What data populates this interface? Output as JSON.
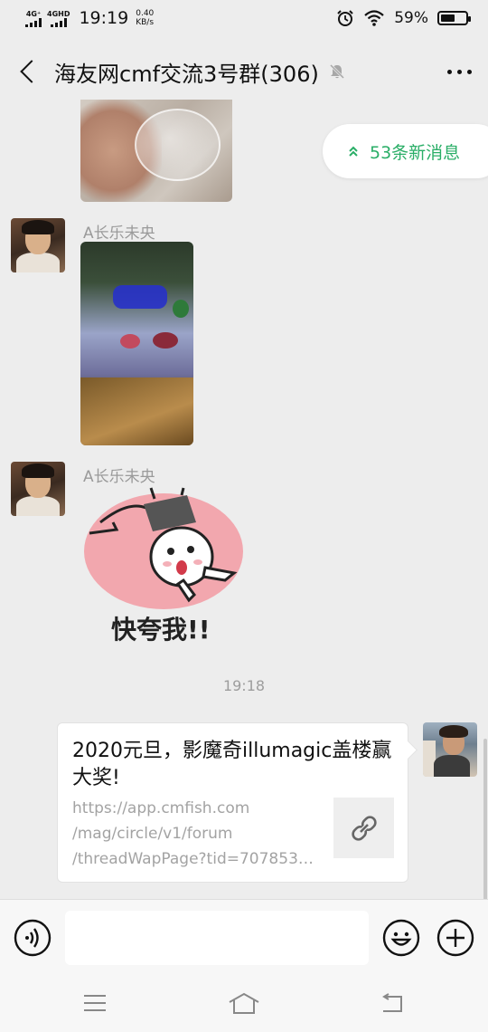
{
  "status_bar": {
    "sim1_label": "4G⁺",
    "sim2_label": "4GHD",
    "time": "19:19",
    "speed_value": "0.40",
    "speed_unit": "KB/s",
    "battery_percent_text": "59%",
    "battery_level": 0.59
  },
  "header": {
    "title": "海友网cmf交流3号群(306)",
    "back_icon": "back-arrow-icon",
    "mute_icon": "bell-muted-icon",
    "more_icon": "more-dots-icon"
  },
  "new_messages_pill": {
    "label": "53条新消息",
    "icon": "double-chevron-up-icon",
    "color": "#2aae67"
  },
  "messages": [
    {
      "type": "image",
      "description_icon": "photo-hand-glass"
    },
    {
      "type": "image",
      "sender": "A长乐未央",
      "description_icon": "photo-aquarium"
    },
    {
      "type": "sticker",
      "sender": "A长乐未央",
      "sticker_text": "快夸我!!"
    }
  ],
  "timestamp": "19:18",
  "link_card": {
    "title": "2020元旦，影魔奇illumagic盖楼赢大奖!",
    "url_lines": [
      "https://app.cmfish.com",
      "/mag/circle/v1/forum",
      "/threadWapPage?tid=707853…"
    ],
    "thumb_icon": "link-icon"
  },
  "input_bar": {
    "voice_icon": "voice-icon",
    "emoji_icon": "emoji-icon",
    "add_icon": "plus-circle-icon",
    "text_value": ""
  },
  "nav_bar": {
    "menu_icon": "menu-icon",
    "home_icon": "home-icon",
    "back_icon": "back-nav-icon"
  }
}
